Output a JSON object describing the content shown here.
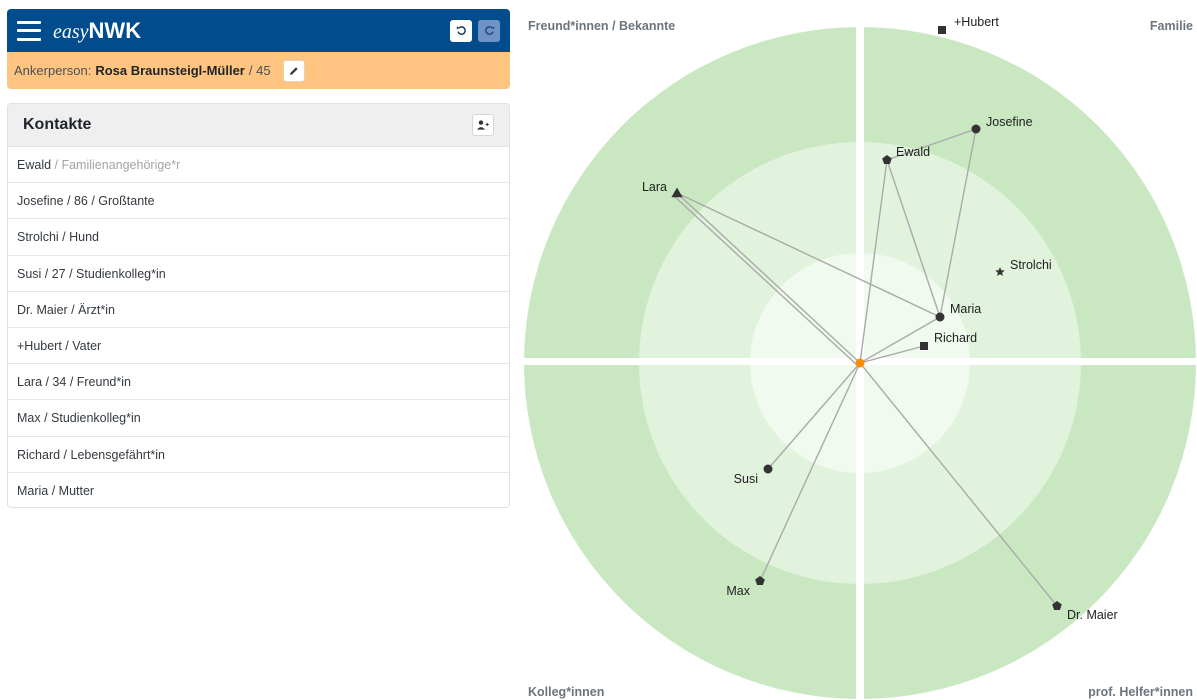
{
  "app": {
    "brand_italic": "easy",
    "brand_bold": "NWK",
    "undo_icon": "undo-icon",
    "redo_icon": "redo-icon",
    "menu_icon": "hamburger-menu-icon"
  },
  "anchor": {
    "label": "Ankerperson:",
    "name": "Rosa Braunsteigl-Müller",
    "age_text": "/ 45",
    "edit_icon": "pencil-icon"
  },
  "contacts": {
    "title": "Kontakte",
    "add_icon": "add-person-icon",
    "items": [
      {
        "main": "Ewald",
        "muted": " / Familienangehörige*r"
      },
      {
        "main": "Josefine / 86 / Großtante",
        "muted": ""
      },
      {
        "main": "Strolchi / Hund",
        "muted": ""
      },
      {
        "main": "Susi / 27 / Studienkolleg*in",
        "muted": ""
      },
      {
        "main": "Dr. Maier / Ärzt*in",
        "muted": ""
      },
      {
        "main": "+Hubert / Vater",
        "muted": ""
      },
      {
        "main": "Lara / 34 / Freund*in",
        "muted": ""
      },
      {
        "main": "Max / Studienkolleg*in",
        "muted": ""
      },
      {
        "main": "Richard / Lebensgefährt*in",
        "muted": ""
      },
      {
        "main": "Maria / Mutter",
        "muted": ""
      }
    ]
  },
  "map": {
    "quadrants": {
      "top_left": "Freund*innen / Bekannte",
      "top_right": "Familie",
      "bottom_left": "Kolleg*innen",
      "bottom_right": "prof. Helfer*innen"
    },
    "colors": {
      "outer_ring": "#c9e8c2",
      "middle_ring": "#e1f3dc",
      "inner_ring": "#f0faee",
      "edge": "#aaaaaa",
      "ego": "#ff8c00",
      "node": "#333333"
    },
    "nodes": [
      {
        "id": "hubert",
        "label": "+Hubert",
        "shape": "square"
      },
      {
        "id": "josefine",
        "label": "Josefine",
        "shape": "circle"
      },
      {
        "id": "ewald",
        "label": "Ewald",
        "shape": "pentagon"
      },
      {
        "id": "lara",
        "label": "Lara",
        "shape": "triangle"
      },
      {
        "id": "strolchi",
        "label": "Strolchi",
        "shape": "star"
      },
      {
        "id": "maria",
        "label": "Maria",
        "shape": "circle"
      },
      {
        "id": "richard",
        "label": "Richard",
        "shape": "square"
      },
      {
        "id": "susi",
        "label": "Susi",
        "shape": "circle"
      },
      {
        "id": "max",
        "label": "Max",
        "shape": "pentagon"
      },
      {
        "id": "drmaier",
        "label": "Dr. Maier",
        "shape": "pentagon"
      }
    ],
    "edges": [
      [
        "ego",
        "lara"
      ],
      [
        "ego",
        "ewald"
      ],
      [
        "ego",
        "susi"
      ],
      [
        "ego",
        "max"
      ],
      [
        "ego",
        "drmaier"
      ],
      [
        "ego",
        "maria"
      ],
      [
        "ego",
        "richard"
      ],
      [
        "lara",
        "maria"
      ],
      [
        "ewald",
        "josefine"
      ],
      [
        "ewald",
        "maria"
      ],
      [
        "josefine",
        "maria"
      ]
    ]
  }
}
